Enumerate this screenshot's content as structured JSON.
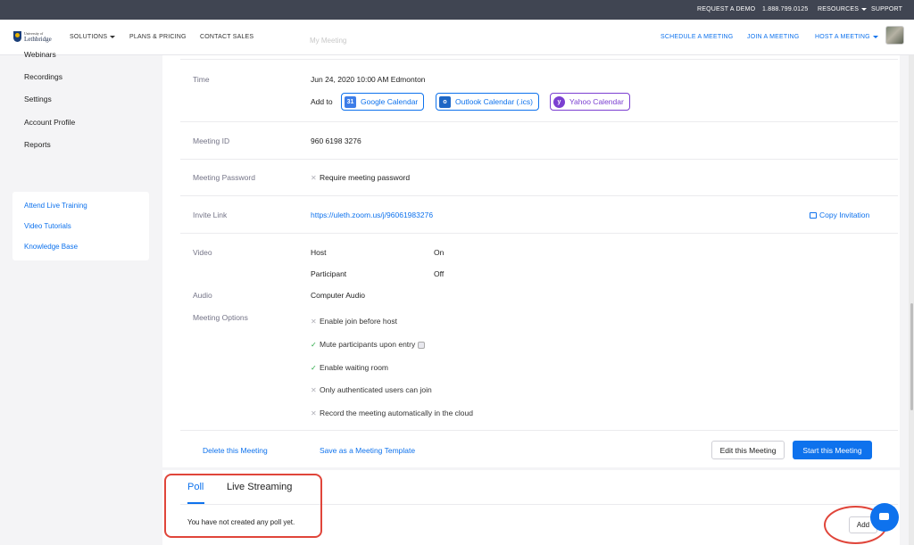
{
  "top_bar": {
    "request_demo": "REQUEST A DEMO",
    "phone": "1.888.799.0125",
    "resources": "RESOURCES",
    "support": "SUPPORT"
  },
  "nav": {
    "logo_line1": "University of",
    "logo_line2": "Lethbridge",
    "solutions": "SOLUTIONS",
    "plans_pricing": "PLANS & PRICING",
    "contact_sales": "CONTACT SALES",
    "schedule_meeting": "SCHEDULE A MEETING",
    "join_meeting": "JOIN A MEETING",
    "host_meeting": "HOST A MEETING",
    "ghost_title": "My Meeting"
  },
  "sidebar": {
    "items": [
      "Webinars",
      "Recordings",
      "Settings",
      "Account Profile",
      "Reports"
    ],
    "help_links": [
      "Attend Live Training",
      "Video Tutorials",
      "Knowledge Base"
    ]
  },
  "meeting": {
    "time_label": "Time",
    "time_value": "Jun 24, 2020 10:00 AM Edmonton",
    "add_to": "Add to",
    "google_calendar": "Google Calendar",
    "outlook_calendar": "Outlook Calendar (.ics)",
    "yahoo_calendar": "Yahoo Calendar",
    "meeting_id_label": "Meeting ID",
    "meeting_id": "960 6198 3276",
    "password_label": "Meeting Password",
    "password_value": "Require meeting password",
    "invite_label": "Invite Link",
    "invite_url": "https://uleth.zoom.us/j/96061983276",
    "copy_invitation": "Copy Invitation",
    "video_label": "Video",
    "host_label": "Host",
    "host_value": "On",
    "participant_label": "Participant",
    "participant_value": "Off",
    "audio_label": "Audio",
    "audio_value": "Computer Audio",
    "options_label": "Meeting Options",
    "options": [
      {
        "text": "Enable join before host",
        "enabled": false
      },
      {
        "text": "Mute participants upon entry",
        "enabled": true
      },
      {
        "text": "Enable waiting room",
        "enabled": true
      },
      {
        "text": "Only authenticated users can join",
        "enabled": false
      },
      {
        "text": "Record the meeting automatically in the cloud",
        "enabled": false
      }
    ],
    "delete": "Delete this Meeting",
    "save_template": "Save as a Meeting Template",
    "edit": "Edit this Meeting",
    "start": "Start this Meeting"
  },
  "poll": {
    "tab_poll": "Poll",
    "tab_live": "Live Streaming",
    "empty_message": "You have not created any poll yet.",
    "add": "Add"
  },
  "colors": {
    "accent": "#0e72ed",
    "top_bar": "#404552",
    "annotation": "#e0453a",
    "yahoo": "#7b3fd1",
    "check": "#27a844"
  }
}
